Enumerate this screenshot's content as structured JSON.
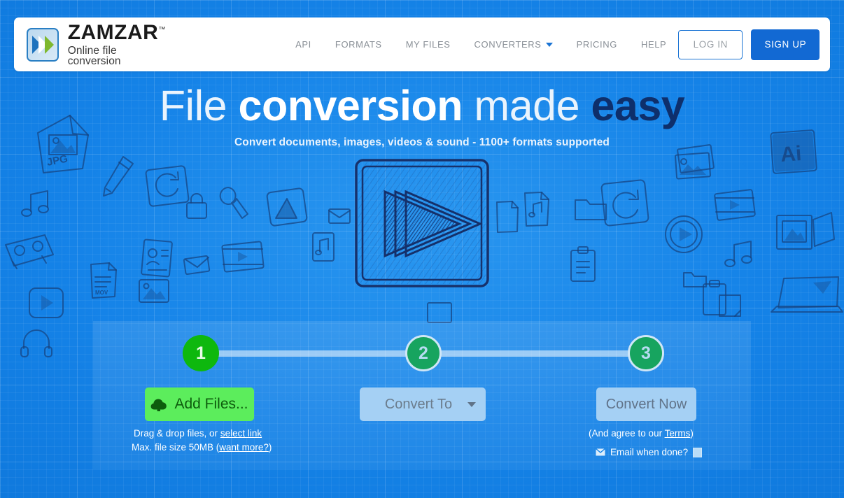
{
  "brand": {
    "name": "ZAMZAR",
    "trademark": "™",
    "tagline": "Online file conversion",
    "logo_icon": "double-chevron-logo-icon",
    "accent_blue": "#1269d3",
    "page_blue": "#1583e8",
    "green": "#0eb80e"
  },
  "nav": {
    "items": [
      {
        "label": "API",
        "name": "nav-api"
      },
      {
        "label": "FORMATS",
        "name": "nav-formats"
      },
      {
        "label": "MY FILES",
        "name": "nav-my-files"
      },
      {
        "label": "CONVERTERS",
        "name": "nav-converters",
        "has_caret": true
      },
      {
        "label": "PRICING",
        "name": "nav-pricing"
      },
      {
        "label": "HELP",
        "name": "nav-help"
      }
    ],
    "login_label": "LOG IN",
    "signup_label": "SIGN UP"
  },
  "hero": {
    "title_part_1": "File ",
    "title_part_2": "conversion",
    "title_part_3": " made ",
    "title_part_4": "easy",
    "subtitle": "Convert documents, images, videos & sound - 1100+ formats supported",
    "art_icon": "fast-forward-chevrons-sketch-icon"
  },
  "widget": {
    "steps": [
      {
        "number": "1",
        "name": "step-1"
      },
      {
        "number": "2",
        "name": "step-2"
      },
      {
        "number": "3",
        "name": "step-3"
      }
    ],
    "add_files_label": "Add Files...",
    "add_files_icon": "cloud-upload-icon",
    "convert_to_label": "Convert To",
    "convert_now_label": "Convert Now",
    "hint_drag_prefix": "Drag & drop files, or ",
    "hint_drag_link": "select link",
    "hint_size_prefix": "Max. file size 50MB (",
    "hint_size_link": "want more?",
    "hint_size_suffix": ")",
    "terms_prefix": "(And agree to our ",
    "terms_link": "Terms",
    "terms_suffix": ")",
    "email_label": "Email when done?",
    "email_icon": "envelope-icon"
  }
}
